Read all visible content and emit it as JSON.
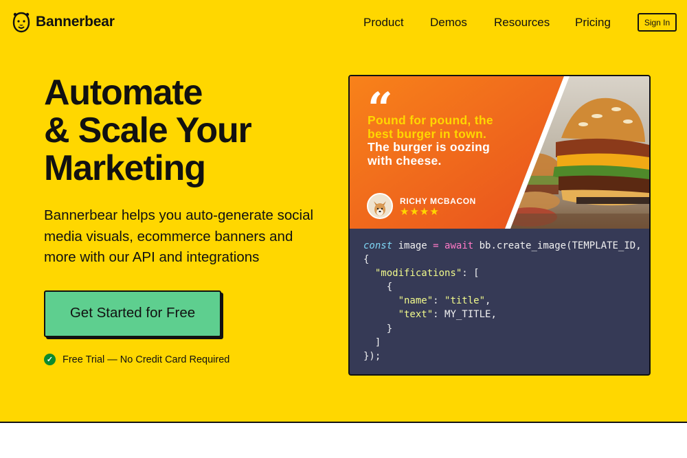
{
  "header": {
    "logo_text": "Bannerbear",
    "nav": [
      {
        "label": "Product"
      },
      {
        "label": "Demos"
      },
      {
        "label": "Resources"
      },
      {
        "label": "Pricing"
      }
    ],
    "signin_label": "Sign In"
  },
  "hero": {
    "headline": [
      "Automate",
      "& Scale Your",
      "Marketing"
    ],
    "subtext": "Bannerbear helps you auto-generate social media visuals, ecommerce banners and more with our API and integrations",
    "cta_label": "Get Started for Free",
    "trial_text": "Free Trial — No Credit Card Required"
  },
  "demo": {
    "quote_highlight": "Pound for pound, the best burger in town.",
    "quote_rest": "The burger is oozing with cheese.",
    "author": "RICHY MCBACON",
    "rating": 4,
    "stars": "★★★★",
    "code": {
      "l1_const": "const",
      "l1_var": " image ",
      "l1_eq": "=",
      "l1_await": "await",
      "l1_call": " bb.create_image(TEMPLATE_ID,",
      "l2": "{",
      "l3_key": "\"modifications\"",
      "l3_rest": ": [",
      "l4": "    {",
      "l5_key": "\"name\"",
      "l5_colon": ": ",
      "l5_val": "\"title\"",
      "l5_comma": ",",
      "l6_key": "\"text\"",
      "l6_rest": ": MY_TITLE,",
      "l7": "    }",
      "l8": "  ]",
      "l9": "});"
    }
  },
  "colors": {
    "hero_bg": "#ffd700",
    "cta_bg": "#5ecf8f",
    "banner_orange": "#f26a1b",
    "code_bg": "#363a56",
    "check_green": "#0e8a2e"
  }
}
